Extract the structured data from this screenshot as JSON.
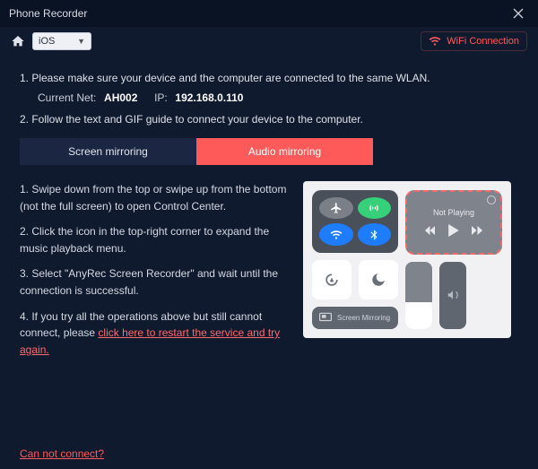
{
  "titlebar": {
    "title": "Phone Recorder"
  },
  "toolbar": {
    "platform": {
      "selected": "iOS"
    },
    "wifi_label": "WiFi Connection"
  },
  "steps_top": {
    "s1": "1. Please make sure your device and the computer are connected to the same WLAN.",
    "current_net_label": "Current Net:",
    "current_net_value": "AH002",
    "ip_label": "IP:",
    "ip_value": "192.168.0.110",
    "s2": "2. Follow the text and GIF guide to connect your device to the computer."
  },
  "tabs": {
    "screen": "Screen mirroring",
    "audio": "Audio mirroring"
  },
  "instructions": {
    "p1": "1. Swipe down from the top or swipe up from the bottom (not the full screen) to open Control Center.",
    "p2": "2. Click the icon in the top-right corner to expand the music playback menu.",
    "p3": "3. Select \"AnyRec Screen Recorder\" and wait until the connection is successful.",
    "p4_a": "4. If you try all the operations above but still cannot connect, please ",
    "p4_link": "click here to restart the service and try again."
  },
  "control_center": {
    "not_playing": "Not Playing",
    "mirroring_label": "Screen Mirroring"
  },
  "footer": {
    "cannot_connect": "Can not connect?"
  },
  "icons": {
    "close": "close-icon",
    "home": "home-icon",
    "chevron": "chevron-down-icon",
    "wifi": "wifi-icon",
    "airplane": "airplane-icon",
    "cellular": "cellular-icon",
    "bluetooth": "bluetooth-icon",
    "lock_rotation": "lock-rotation-icon",
    "moon": "moon-icon",
    "cast": "cast-icon",
    "mute": "mute-icon",
    "play": "play-icon",
    "back": "back-icon",
    "fwd": "forward-icon"
  }
}
